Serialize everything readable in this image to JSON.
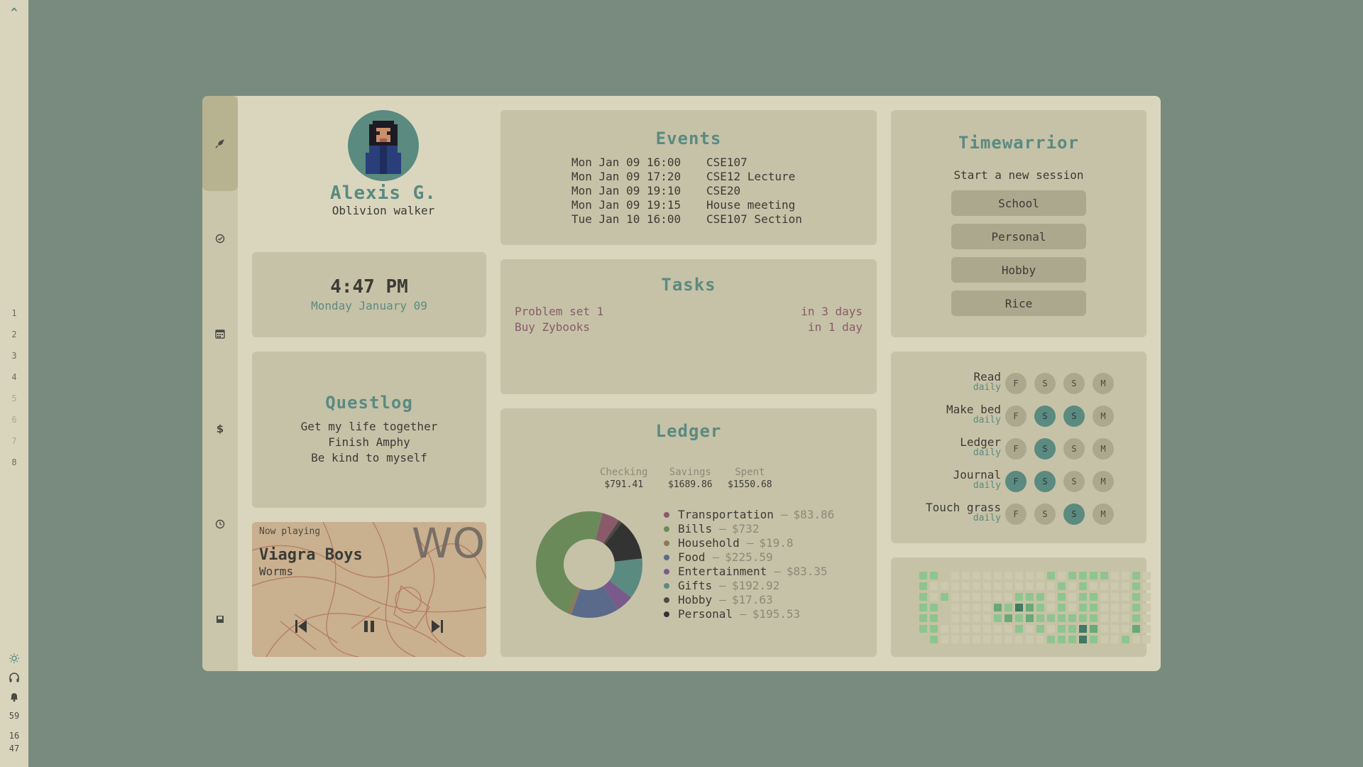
{
  "sysbar": {
    "logo": "^",
    "workspaces": [
      "1",
      "2",
      "3",
      "4",
      "5",
      "6",
      "7",
      "8"
    ],
    "active_workspaces": [
      0,
      1,
      2,
      3,
      7
    ],
    "status": {
      "volume": "59",
      "clock_hour": "16",
      "clock_min": "47"
    }
  },
  "profile": {
    "name": "Alexis G.",
    "tagline": "Oblivion walker"
  },
  "clock": {
    "time": "4:47 PM",
    "date": "Monday January 09"
  },
  "questlog": {
    "title": "Questlog",
    "items": [
      "Get my life together",
      "Finish Amphy",
      "Be kind to myself"
    ]
  },
  "music": {
    "label": "Now playing",
    "artist": "Viagra Boys",
    "track": "Worms",
    "art_text": "WOR"
  },
  "events": {
    "title": "Events",
    "items": [
      {
        "date": "Mon Jan 09 16:00",
        "name": "CSE107"
      },
      {
        "date": "Mon Jan 09 17:20",
        "name": "CSE12 Lecture"
      },
      {
        "date": "Mon Jan 09 19:10",
        "name": "CSE20"
      },
      {
        "date": "Mon Jan 09 19:15",
        "name": "House meeting"
      },
      {
        "date": "Tue Jan 10 16:00",
        "name": "CSE107 Section"
      }
    ]
  },
  "tasks": {
    "title": "Tasks",
    "items": [
      {
        "name": "Problem set 1",
        "due": "in 3 days"
      },
      {
        "name": "Buy Zybooks",
        "due": "in 1 day"
      }
    ]
  },
  "ledger": {
    "title": "Ledger",
    "accounts": [
      {
        "label": "Checking",
        "value": "$791.41"
      },
      {
        "label": "Savings",
        "value": "$1689.86"
      },
      {
        "label": "Spent",
        "value": "$1550.68"
      }
    ],
    "categories": [
      {
        "name": "Transportation",
        "amount": "$83.86",
        "value": 83.86,
        "color": "#8a5a6a"
      },
      {
        "name": "Bills",
        "amount": "$732",
        "value": 732,
        "color": "#6b8a5a"
      },
      {
        "name": "Household",
        "amount": "$19.8",
        "value": 19.8,
        "color": "#8a7a5a"
      },
      {
        "name": "Food",
        "amount": "$225.59",
        "value": 225.59,
        "color": "#5a6a8a"
      },
      {
        "name": "Entertainment",
        "amount": "$83.35",
        "value": 83.35,
        "color": "#7a5a8a"
      },
      {
        "name": "Gifts",
        "amount": "$192.92",
        "value": 192.92,
        "color": "#5b8a80"
      },
      {
        "name": "Hobby",
        "amount": "$17.63",
        "value": 17.63,
        "color": "#4a4a44"
      },
      {
        "name": "Personal",
        "amount": "$195.53",
        "value": 195.53,
        "color": "#333333"
      }
    ],
    "separator": "–"
  },
  "timewarrior": {
    "title": "Timewarrior",
    "subtitle": "Start a new session",
    "buttons": [
      "School",
      "Personal",
      "Hobby",
      "Rice"
    ]
  },
  "habits": {
    "days": [
      "F",
      "S",
      "S",
      "M"
    ],
    "items": [
      {
        "name": "Read",
        "freq": "daily",
        "done": [
          false,
          false,
          false,
          false
        ]
      },
      {
        "name": "Make bed",
        "freq": "daily",
        "done": [
          false,
          true,
          true,
          false
        ]
      },
      {
        "name": "Ledger",
        "freq": "daily",
        "done": [
          false,
          true,
          false,
          false
        ]
      },
      {
        "name": "Journal",
        "freq": "daily",
        "done": [
          true,
          true,
          false,
          false
        ]
      },
      {
        "name": "Touch grass",
        "freq": "daily",
        "done": [
          false,
          false,
          true,
          false
        ]
      }
    ]
  },
  "heatmap": {
    "colors": [
      "#c6c2a7",
      "#cdc9ae",
      "#8fc48f",
      "#6aa878",
      "#3f7a62"
    ],
    "weeks": [
      [
        2,
        2,
        2,
        2,
        2,
        2,
        0
      ],
      [
        2,
        1,
        1,
        2,
        2,
        2,
        2
      ],
      [
        0,
        1,
        2,
        0,
        0,
        1,
        1
      ],
      [
        1,
        1,
        1,
        1,
        1,
        1,
        1
      ],
      [
        1,
        1,
        1,
        1,
        1,
        1,
        1
      ],
      [
        1,
        1,
        1,
        1,
        1,
        1,
        1
      ],
      [
        1,
        1,
        1,
        1,
        1,
        1,
        1
      ],
      [
        1,
        1,
        1,
        3,
        2,
        1,
        1
      ],
      [
        1,
        1,
        1,
        2,
        3,
        1,
        1
      ],
      [
        1,
        1,
        2,
        4,
        2,
        2,
        1
      ],
      [
        1,
        1,
        2,
        3,
        3,
        1,
        1
      ],
      [
        1,
        1,
        2,
        2,
        2,
        2,
        1
      ],
      [
        2,
        1,
        1,
        1,
        2,
        1,
        2
      ],
      [
        1,
        2,
        2,
        2,
        2,
        2,
        2
      ],
      [
        2,
        1,
        1,
        1,
        2,
        2,
        2
      ],
      [
        2,
        2,
        2,
        2,
        2,
        4,
        4
      ],
      [
        2,
        1,
        2,
        2,
        2,
        3,
        2
      ],
      [
        2,
        1,
        1,
        1,
        1,
        1,
        1
      ],
      [
        1,
        1,
        1,
        1,
        1,
        1,
        1
      ],
      [
        1,
        1,
        1,
        1,
        1,
        1,
        2
      ],
      [
        2,
        2,
        2,
        2,
        2,
        3,
        1
      ],
      [
        1,
        1,
        1,
        1,
        1,
        1,
        1
      ]
    ]
  }
}
